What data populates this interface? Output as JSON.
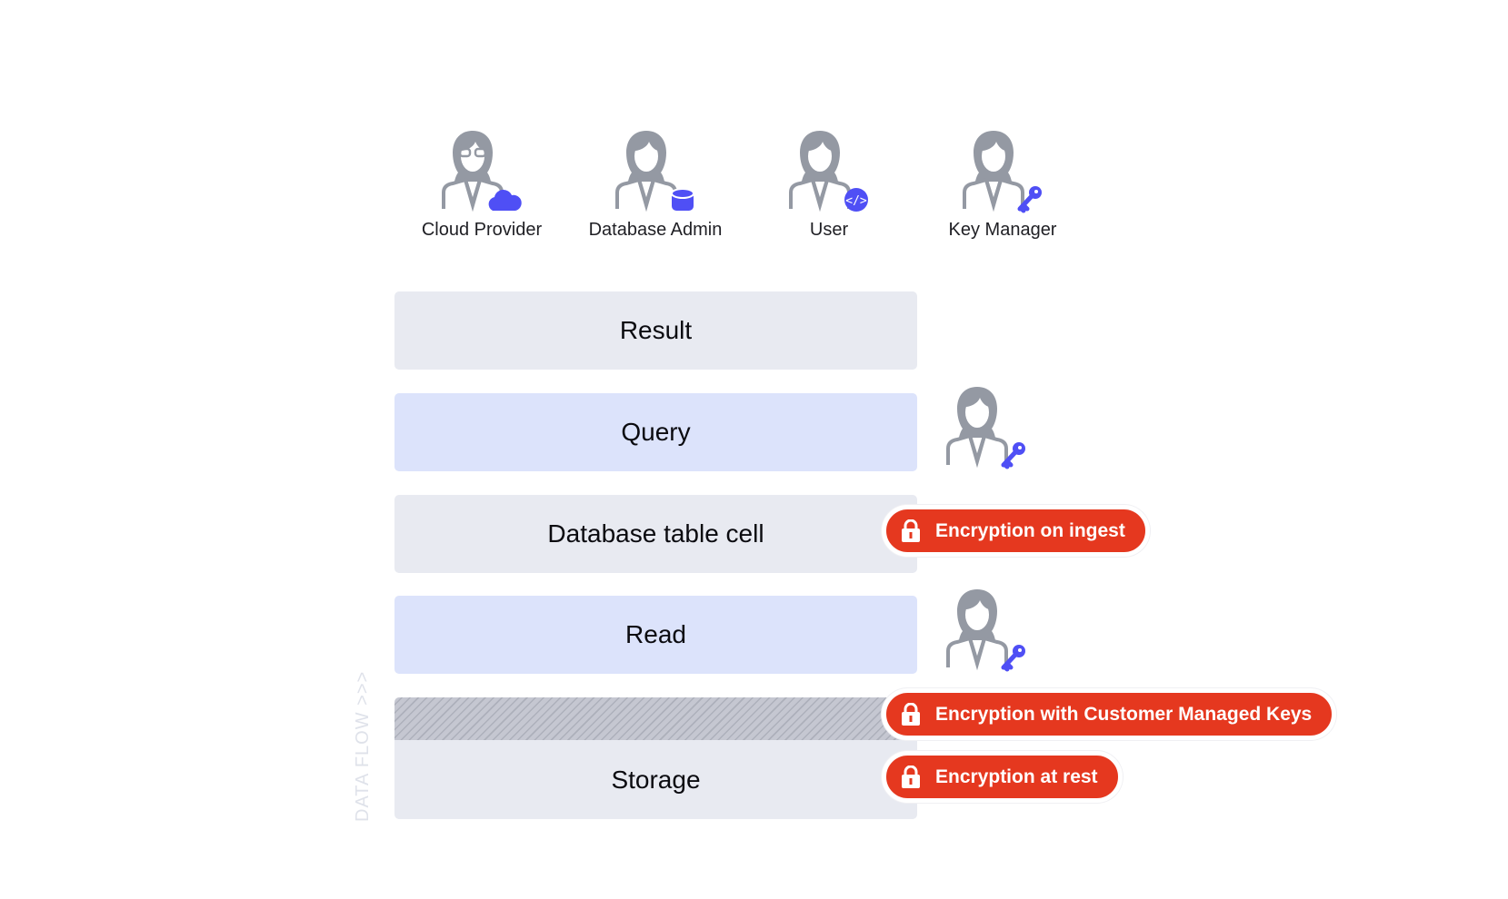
{
  "roles": [
    {
      "label": "Cloud Provider",
      "badge": "cloud-icon"
    },
    {
      "label": "Database Admin",
      "badge": "database-icon"
    },
    {
      "label": "User",
      "badge": "code-icon"
    },
    {
      "label": "Key Manager",
      "badge": "key-icon"
    }
  ],
  "layers": {
    "result": "Result",
    "query": "Query",
    "cell": "Database table cell",
    "read": "Read",
    "storage": "Storage"
  },
  "badges": {
    "ingest": "Encryption on ingest",
    "cmk": "Encryption with Customer Managed Keys",
    "rest": "Encryption at rest"
  },
  "flow_label": "DATA FLOW >>>",
  "colors": {
    "accent": "#4f4ff5",
    "badge": "#e5381f",
    "icon": "#9499a3",
    "layer_grey": "#e8eaf1",
    "layer_blue": "#dce3fb"
  }
}
